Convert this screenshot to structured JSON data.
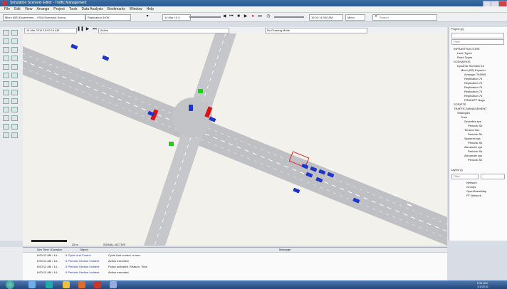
{
  "window": {
    "title": "Simulation Scenario Editor - Traffic Management"
  },
  "menu": [
    "File",
    "Edit",
    "View",
    "Arrange",
    "Project",
    "Tools",
    "Data Analysis",
    "Bookmarks",
    "Window",
    "Help"
  ],
  "toolbar": {
    "project_combo": "Micro (BS) Experiment – VSN (Scenario) Scena",
    "replication_combo": "Replication 3408",
    "time_start": "14 Mar 10 4",
    "time_current": "15:02:14.000 AM",
    "speed_combo": "Micro",
    "search_placeholder": "Search"
  },
  "viewbar": {
    "date": "14 Mar 2016 15:02:14 AM",
    "mode": "Active",
    "layer": "No Drawing Mode"
  },
  "viewport": {
    "scale_label": "25 m",
    "status_text": "SIGNAL: ACTIVE"
  },
  "log": {
    "columns": [
      "Sim Time / Duration",
      "Object",
      "Message"
    ],
    "rows": [
      {
        "time": "8:00:12 AM / 14...",
        "object": "5 Cycle Unit Control",
        "message": "Cycle Unit control: a new..."
      },
      {
        "time": "8:00:12 AM / 14...",
        "object": "5 Periodic Section Incident",
        "message": "Action executed."
      },
      {
        "time": "8:00:12 AM / 14...",
        "object": "5 Periodic Section Incident",
        "message": "Policy activated. Reason: Time."
      },
      {
        "time": "8:00:12 AM / 14...",
        "object": "5 Periodic Section Incident",
        "message": "Action executed."
      }
    ]
  },
  "project": {
    "title": "Project (p)",
    "filter_placeholder": "Filter",
    "tree": [
      {
        "indent": 0,
        "label": "INFRASTRUCTURE"
      },
      {
        "indent": 1,
        "label": "Lane Types"
      },
      {
        "indent": 1,
        "label": "Road Types"
      },
      {
        "indent": 0,
        "label": "SCENARIOS"
      },
      {
        "indent": 1,
        "label": "Dynamic Scenario 10"
      },
      {
        "indent": 2,
        "label": "Micro (BS) Experim"
      },
      {
        "indent": 3,
        "label": "Average: 746595"
      },
      {
        "indent": 3,
        "label": "Replication 74"
      },
      {
        "indent": 3,
        "label": "Replication 74"
      },
      {
        "indent": 3,
        "label": "Replication 74"
      },
      {
        "indent": 3,
        "label": "Replication 74"
      },
      {
        "indent": 3,
        "label": "Replication 74"
      },
      {
        "indent": 3,
        "label": "FRAKAFF Nsga"
      },
      {
        "indent": 0,
        "label": "SCRIPTS"
      },
      {
        "indent": 0,
        "label": "TRAFFIC MANAGEMENT"
      },
      {
        "indent": 1,
        "label": "Strategies"
      },
      {
        "indent": 2,
        "label": "Tram"
      },
      {
        "indent": 3,
        "label": "Secretles sys"
      },
      {
        "indent": 4,
        "label": "Periodic Se"
      },
      {
        "indent": 3,
        "label": "Tension sho"
      },
      {
        "indent": 4,
        "label": "Periodic Se"
      },
      {
        "indent": 3,
        "label": "Sipperini sys"
      },
      {
        "indent": 4,
        "label": "Periodic Se"
      },
      {
        "indent": 3,
        "label": "Alexander sys"
      },
      {
        "indent": 4,
        "label": "Periodic Se"
      },
      {
        "indent": 3,
        "label": "Alexander sys"
      },
      {
        "indent": 4,
        "label": "Periodic Se"
      }
    ]
  },
  "layers": {
    "title": "Layers (l)",
    "filter_placeholder": "Filter",
    "items": [
      "Network",
      "Groups",
      "OpenStreetMap",
      "PT Network"
    ]
  },
  "taskbar": {
    "time": "6:51 AM",
    "date": "1/1/2016"
  }
}
